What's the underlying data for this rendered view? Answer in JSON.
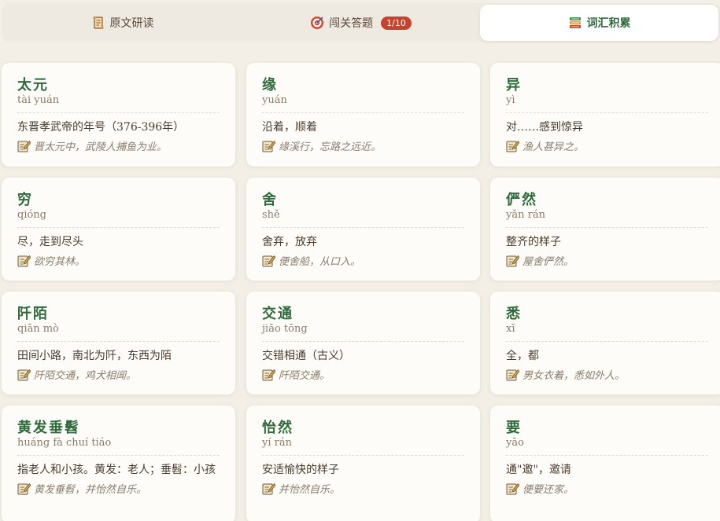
{
  "tabs": [
    {
      "label": "原文研读",
      "icon": "scroll-icon",
      "active": false
    },
    {
      "label": "闯关答题",
      "icon": "target-icon",
      "badge": "1/10",
      "active": false
    },
    {
      "label": "词汇积累",
      "icon": "books-icon",
      "active": true
    }
  ],
  "vocab": [
    {
      "word": "太元",
      "pinyin": "tài yuán",
      "meaning": "东晋孝武帝的年号（376-396年）",
      "example": "晋太元中，武陵人捕鱼为业。"
    },
    {
      "word": "缘",
      "pinyin": "yuán",
      "meaning": "沿着，顺着",
      "example": "缘溪行，忘路之远近。"
    },
    {
      "word": "异",
      "pinyin": "yì",
      "meaning": "对……感到惊异",
      "example": "渔人甚异之。"
    },
    {
      "word": "穷",
      "pinyin": "qióng",
      "meaning": "尽，走到尽头",
      "example": "欲穷其林。"
    },
    {
      "word": "舍",
      "pinyin": "shě",
      "meaning": "舍弃，放弃",
      "example": "便舍船，从口入。"
    },
    {
      "word": "俨然",
      "pinyin": "yǎn rán",
      "meaning": "整齐的样子",
      "example": "屋舍俨然。"
    },
    {
      "word": "阡陌",
      "pinyin": "qiān mò",
      "meaning": "田间小路，南北为阡，东西为陌",
      "example": "阡陌交通，鸡犬相闻。"
    },
    {
      "word": "交通",
      "pinyin": "jiāo tōng",
      "meaning": "交错相通（古义）",
      "example": "阡陌交通。"
    },
    {
      "word": "悉",
      "pinyin": "xī",
      "meaning": "全，都",
      "example": "男女衣着，悉如外人。"
    },
    {
      "word": "黄发垂髫",
      "pinyin": "huáng fà chuí tiáo",
      "meaning": "指老人和小孩。黄发：老人；垂髫：小孩",
      "example": "黄发垂髫，并怡然自乐。"
    },
    {
      "word": "怡然",
      "pinyin": "yí rán",
      "meaning": "安适愉快的样子",
      "example": "并怡然自乐。"
    },
    {
      "word": "要",
      "pinyin": "yāo",
      "meaning": "通\"邀\"，邀请",
      "example": "便要还家。"
    }
  ],
  "colors": {
    "accent": "#2f6b3a",
    "badge": "#c8432e",
    "background": "#f3efe6"
  }
}
